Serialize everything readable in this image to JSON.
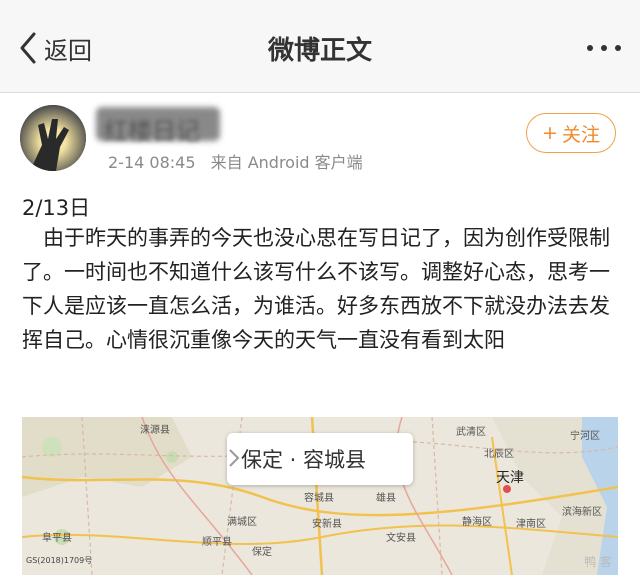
{
  "navbar": {
    "back_label": "返回",
    "title": "微博正文"
  },
  "post": {
    "username": "红楼日记",
    "time": "2-14 08:45",
    "source": "来自 Android 客户端",
    "follow_label": "关注",
    "date_line": "2/13日",
    "body": "由于昨天的事弄的今天也没心思在写日记了，因为创作受限制了。一时间也不知道什么该写什么不该写。调整好心态，思考一下人是应该一直怎么活，为谁活。好多东西放不下就没办法去发挥自己。心情很沉重像今天的天气一直没有看到太阳"
  },
  "map": {
    "location_label": "保定 · 容城县",
    "labels": {
      "tianjin": "天津",
      "baoding": "保定",
      "laishui": "涞源县",
      "mancheng": "满城区",
      "anxin": "安新县",
      "wenan": "文安县",
      "jinghai": "静海区",
      "jinnan": "津南区",
      "binhai": "滨海新区",
      "rongcheng": "容城县",
      "xiong": "雄县",
      "fuping": "阜平县",
      "shunping": "顺平县",
      "ninghe": "宁河区",
      "beichen": "北辰区",
      "wuqing": "武清区"
    },
    "copyright": "GS(2018)1709号",
    "watermark": "鸭 客"
  },
  "colors": {
    "accent": "#f08a2a",
    "nav_bg": "#f7f7f7",
    "text": "#222222"
  }
}
